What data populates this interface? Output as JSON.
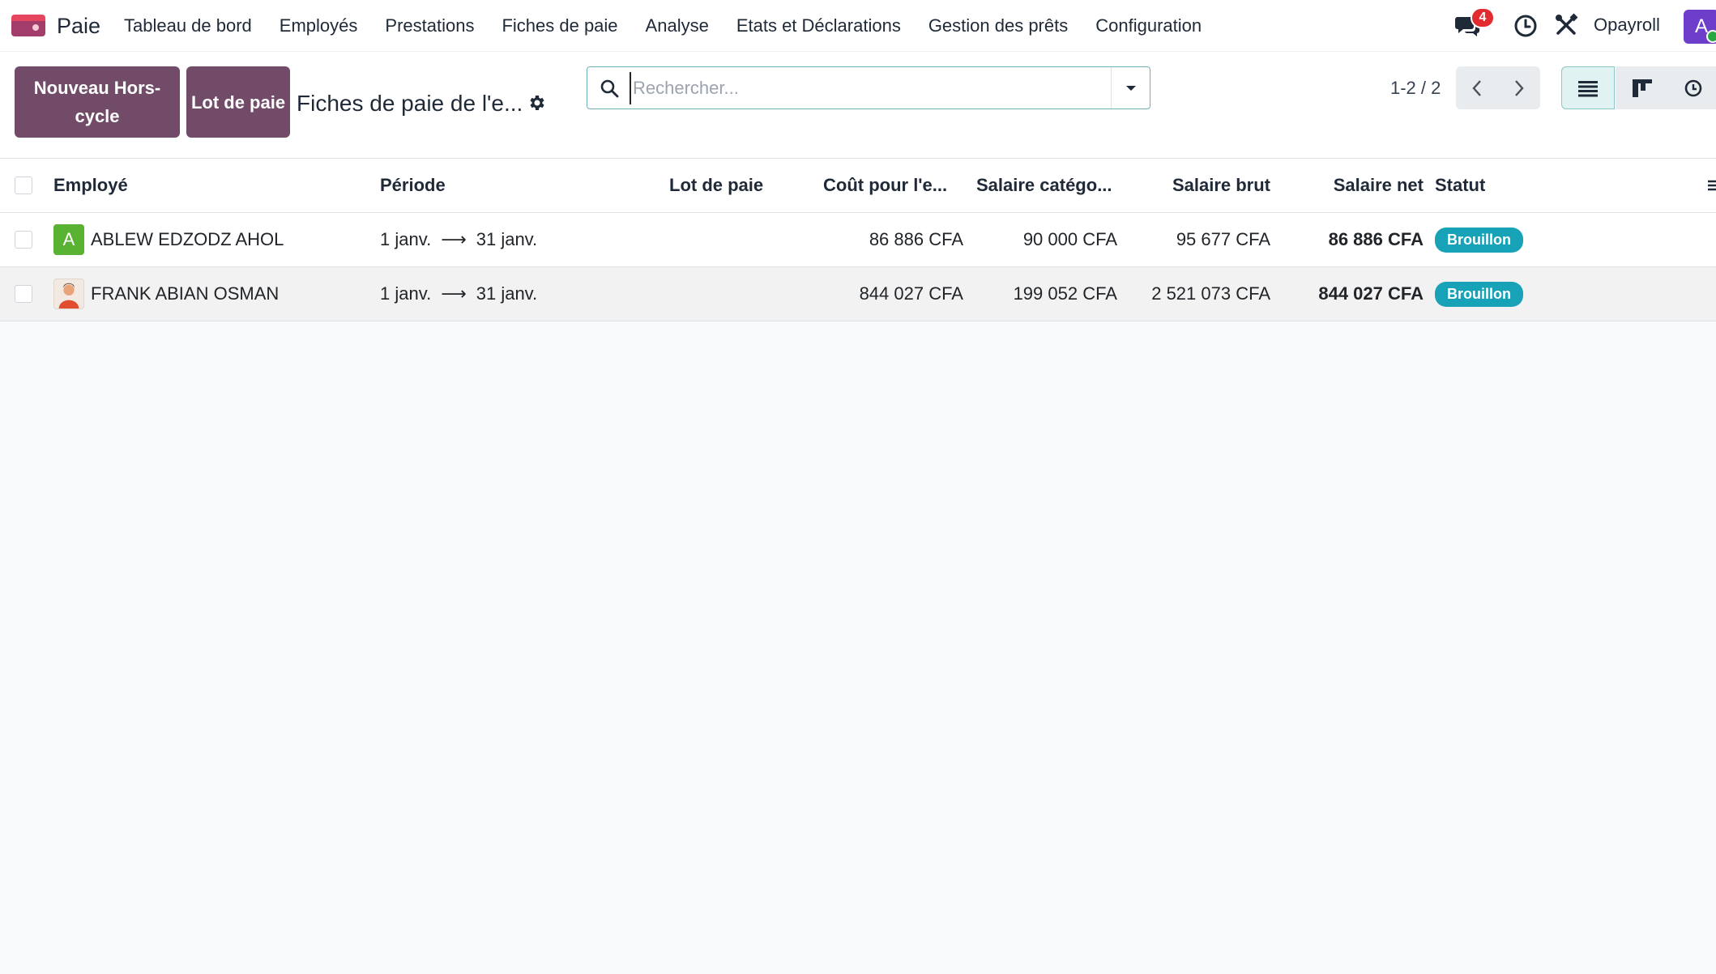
{
  "app": {
    "name": "Paie"
  },
  "menu": [
    "Tableau de bord",
    "Employés",
    "Prestations",
    "Fiches de paie",
    "Analyse",
    "Etats et Déclarations",
    "Gestion des prêts",
    "Configuration"
  ],
  "systray": {
    "messages_count": "4",
    "company": "Opayroll",
    "user_initial": "A"
  },
  "control": {
    "new_button": "Nouveau Hors-cycle",
    "lot_button": "Lot de paie",
    "title": "Fiches de paie de l'e...",
    "search_placeholder": "Rechercher...",
    "pager": "1-2 / 2"
  },
  "table": {
    "columns": {
      "employee": "Employé",
      "period": "Période",
      "batch": "Lot de paie",
      "cost": "Coût pour l'e...",
      "category_salary": "Salaire catégo...",
      "gross": "Salaire brut",
      "net": "Salaire net",
      "status": "Statut"
    },
    "rows": [
      {
        "initial": "A",
        "employee": "ABLEW EDZODZ AHOL",
        "period_start": "1 janv.",
        "period_end": "31 janv.",
        "batch": "",
        "cost": "86 886 CFA",
        "category_salary": "90 000 CFA",
        "gross": "95 677 CFA",
        "net": "86 886 CFA",
        "status": "Brouillon"
      },
      {
        "initial": "",
        "employee": "FRANK ABIAN OSMAN",
        "period_start": "1 janv.",
        "period_end": "31 janv.",
        "batch": "",
        "cost": "844 027 CFA",
        "category_salary": "199 052 CFA",
        "gross": "2 521 073 CFA",
        "net": "844 027 CFA",
        "status": "Brouillon"
      }
    ]
  },
  "colors": {
    "primary": "#714b67",
    "status_draft": "#17a2b8",
    "accent": "#6fb3b8"
  }
}
